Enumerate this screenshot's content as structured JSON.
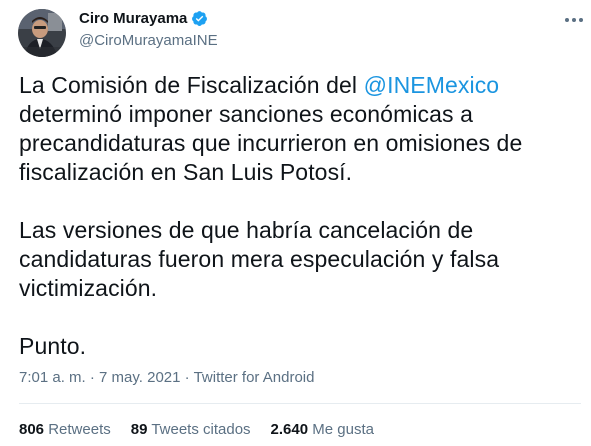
{
  "author": {
    "name": "Ciro Murayama",
    "handle": "@CiroMurayamaINE",
    "verified": true,
    "avatar_icon": "profile-photo"
  },
  "tweet": {
    "paragraph1_before_mention": "La Comisión de Fiscalización del ",
    "mention": "@INEMexico",
    "paragraph1_after_mention": " determinó imponer sanciones económicas a precandidaturas que incurrieron en omisiones de fiscalización en San Luis Potosí.",
    "paragraph2": "Las versiones de que habría cancelación de candidaturas fueron mera especulación y falsa victimización.",
    "paragraph3": "Punto."
  },
  "meta": {
    "time": "7:01 a. m.",
    "separator1": "·",
    "date": "7 may. 2021",
    "separator2": "·",
    "client": "Twitter for Android"
  },
  "stats": {
    "retweets_count": "806",
    "retweets_label": "Retweets",
    "quotes_count": "89",
    "quotes_label": "Tweets citados",
    "likes_count": "2.640",
    "likes_label": "Me gusta"
  },
  "colors": {
    "link": "#1b95e0",
    "secondary_text": "#5b7083",
    "verified_badge": "#1da1f2"
  }
}
